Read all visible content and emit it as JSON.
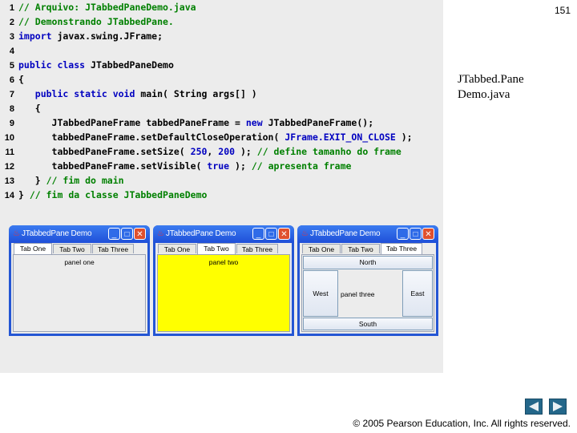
{
  "page_number": "151",
  "side_title_line1": "JTabbed.Pane",
  "side_title_line2": "Demo.java",
  "code_lines": [
    {
      "n": "1",
      "tokens": [
        {
          "t": "// Arquivo: JTabbedPaneDemo.java",
          "k": "comment"
        }
      ]
    },
    {
      "n": "2",
      "tokens": [
        {
          "t": "// Demonstrando JTabbedPane.",
          "k": "comment"
        }
      ]
    },
    {
      "n": "3",
      "tokens": [
        {
          "t": "import",
          "k": "keyword"
        },
        {
          "t": " javax.swing.JFrame;",
          "k": "plain"
        }
      ]
    },
    {
      "n": "4",
      "tokens": []
    },
    {
      "n": "5",
      "tokens": [
        {
          "t": "public class",
          "k": "keyword"
        },
        {
          "t": " JTabbedPaneDemo",
          "k": "plain"
        }
      ]
    },
    {
      "n": "6",
      "tokens": [
        {
          "t": "{",
          "k": "plain"
        }
      ]
    },
    {
      "n": "7",
      "tokens": [
        {
          "t": "   public static void",
          "k": "keyword"
        },
        {
          "t": " main( String args[] )",
          "k": "plain"
        }
      ]
    },
    {
      "n": "8",
      "tokens": [
        {
          "t": "   {",
          "k": "plain"
        }
      ]
    },
    {
      "n": "9",
      "tokens": [
        {
          "t": "      JTabbedPaneFrame tabbedPaneFrame = ",
          "k": "plain"
        },
        {
          "t": "new",
          "k": "keyword"
        },
        {
          "t": " JTabbedPaneFrame();",
          "k": "plain"
        }
      ]
    },
    {
      "n": "10",
      "tokens": [
        {
          "t": "      tabbedPaneFrame.setDefaultCloseOperation( ",
          "k": "plain"
        },
        {
          "t": "JFrame.EXIT_ON_CLOSE",
          "k": "constant"
        },
        {
          "t": " );",
          "k": "plain"
        }
      ]
    },
    {
      "n": "11",
      "tokens": [
        {
          "t": "      tabbedPaneFrame.setSize( ",
          "k": "plain"
        },
        {
          "t": "250",
          "k": "number"
        },
        {
          "t": ", ",
          "k": "plain"
        },
        {
          "t": "200",
          "k": "number"
        },
        {
          "t": " ); ",
          "k": "plain"
        },
        {
          "t": "// define tamanho do frame",
          "k": "comment"
        }
      ]
    },
    {
      "n": "12",
      "tokens": [
        {
          "t": "      tabbedPaneFrame.setVisible( ",
          "k": "plain"
        },
        {
          "t": "true",
          "k": "keyword"
        },
        {
          "t": " ); ",
          "k": "plain"
        },
        {
          "t": "// apresenta frame",
          "k": "comment"
        }
      ]
    },
    {
      "n": "13",
      "tokens": [
        {
          "t": "   } ",
          "k": "plain"
        },
        {
          "t": "// fim do main",
          "k": "comment"
        }
      ]
    },
    {
      "n": "14",
      "tokens": [
        {
          "t": "} ",
          "k": "plain"
        },
        {
          "t": "// fim da classe JTabbedPaneDemo",
          "k": "comment"
        }
      ]
    }
  ],
  "windows": [
    {
      "title": "JTabbedPane Demo",
      "tabs": [
        "Tab One",
        "Tab Two",
        "Tab Three"
      ],
      "active_tab": "Tab One",
      "panel_label": "panel one"
    },
    {
      "title": "JTabbedPane Demo",
      "tabs": [
        "Tab One",
        "Tab Two",
        "Tab Three"
      ],
      "active_tab": "Tab Two",
      "panel_label": "panel two",
      "panel_color": "#ffff00"
    },
    {
      "title": "JTabbedPane Demo",
      "tabs": [
        "Tab One",
        "Tab Two",
        "Tab Three"
      ],
      "active_tab": "Tab Three",
      "north": "North",
      "west": "West",
      "center": "panel three",
      "east": "East",
      "south": "South"
    }
  ],
  "window_controls": {
    "minimize": "_",
    "maximize": "□",
    "close": "✕"
  },
  "nav": {
    "prev_icon": "left-arrow-icon",
    "next_icon": "right-arrow-icon"
  },
  "copyright": "© 2005 Pearson Education, Inc. All rights reserved."
}
